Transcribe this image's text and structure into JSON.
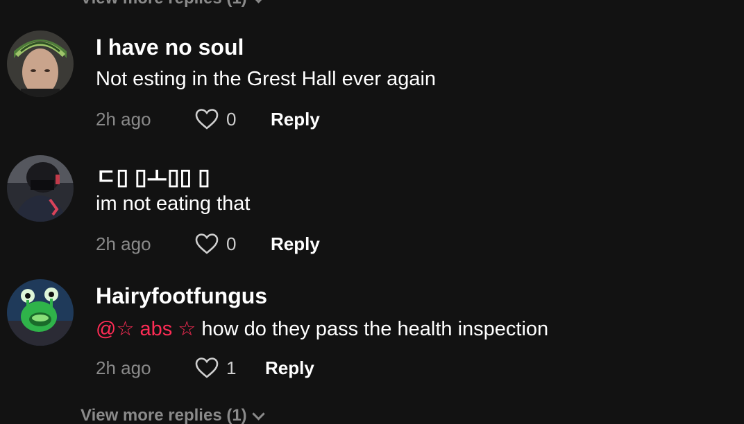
{
  "view_more_top": "View more replies (1)",
  "view_more_bottom": "View more replies (1)",
  "comments": [
    {
      "username": "I have no soul",
      "text": "Not esting in the Grest Hall ever again",
      "mention": "",
      "time": "2h ago",
      "likes": "0",
      "reply": "Reply"
    },
    {
      "username": "ㄷ▯ ▯ㅗ▯▯ ▯",
      "text": "im not eating that",
      "mention": "",
      "time": "2h ago",
      "likes": "0",
      "reply": "Reply"
    },
    {
      "username": "Hairyfootfungus",
      "mention": "@☆ abs ☆",
      "text": " how do they pass the health inspection",
      "time": "2h ago",
      "likes": "1",
      "reply": "Reply"
    }
  ],
  "colors": {
    "background": "#121212",
    "mention": "#fe2c55",
    "muted": "#8a8a8a"
  }
}
